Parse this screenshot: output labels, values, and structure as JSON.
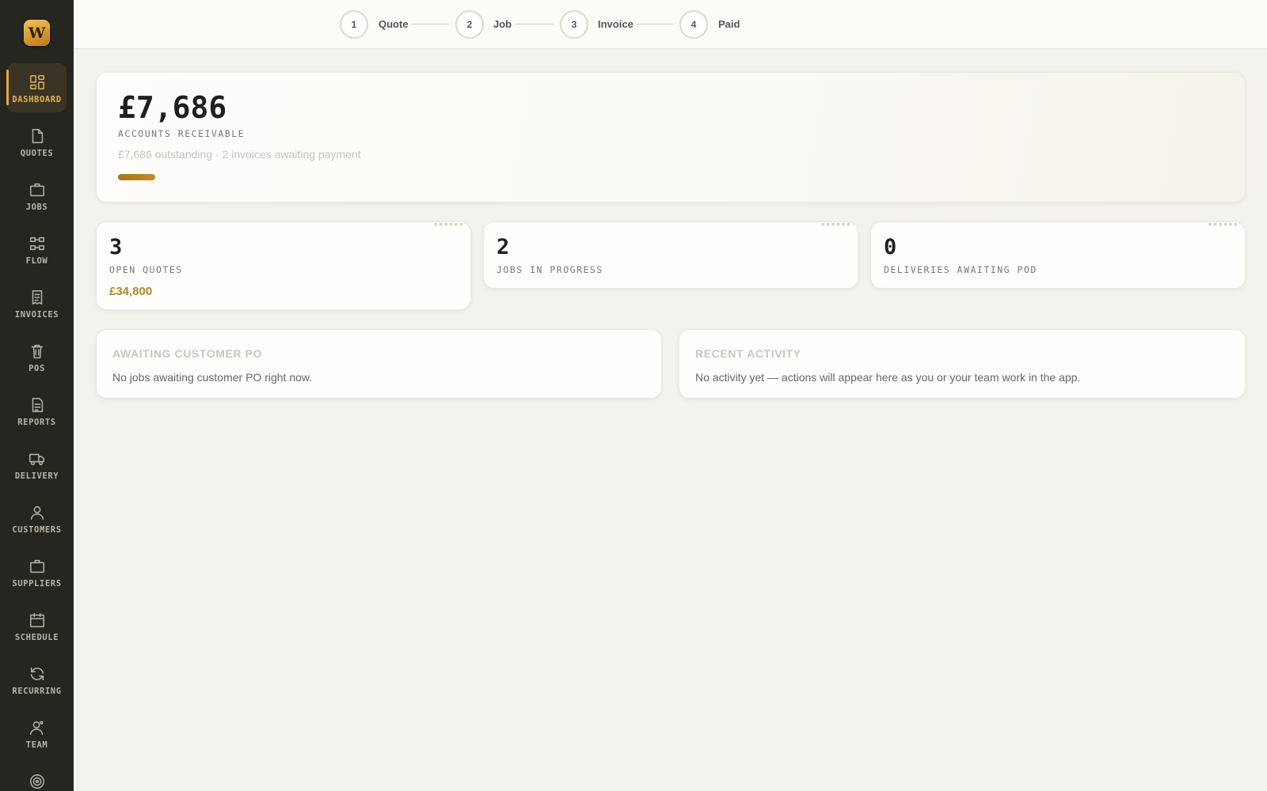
{
  "app": {
    "logo_letter": "W"
  },
  "sidebar": {
    "items": [
      {
        "label": "DASHBOARD",
        "icon": "dashboard-icon",
        "active": true
      },
      {
        "label": "QUOTES",
        "icon": "document-icon"
      },
      {
        "label": "JOBS",
        "icon": "briefcase-icon"
      },
      {
        "label": "FLOW",
        "icon": "flow-icon"
      },
      {
        "label": "INVOICES",
        "icon": "receipt-icon"
      },
      {
        "label": "POS",
        "icon": "trash-icon"
      },
      {
        "label": "REPORTS",
        "icon": "report-icon"
      },
      {
        "label": "DELIVERY",
        "icon": "truck-icon"
      },
      {
        "label": "CUSTOMERS",
        "icon": "user-icon"
      },
      {
        "label": "SUPPLIERS",
        "icon": "briefcase-icon"
      },
      {
        "label": "SCHEDULE",
        "icon": "calendar-icon"
      },
      {
        "label": "RECURRING",
        "icon": "refresh-icon"
      },
      {
        "label": "TEAM",
        "icon": "team-icon"
      }
    ]
  },
  "workflow": {
    "steps": [
      {
        "number": "1",
        "label": "Quote"
      },
      {
        "number": "2",
        "label": "Job"
      },
      {
        "number": "3",
        "label": "Invoice"
      },
      {
        "number": "4",
        "label": "Paid"
      }
    ]
  },
  "receivables": {
    "amount": "£7,686",
    "label": "ACCOUNTS RECEIVABLE",
    "subtitle": "£7,686 outstanding · 2 invoices awaiting payment"
  },
  "stats": [
    {
      "number": "3",
      "label": "OPEN QUOTES",
      "value": "£34,800"
    },
    {
      "number": "2",
      "label": "JOBS IN PROGRESS"
    },
    {
      "number": "0",
      "label": "DELIVERIES AWAITING POD"
    }
  ],
  "panels": {
    "awaiting_po": {
      "title": "AWAITING CUSTOMER PO",
      "text": "No jobs awaiting customer PO right now."
    },
    "recent_activity": {
      "title": "RECENT ACTIVITY",
      "text": "No activity yet — actions will appear here as you or your team work in the app."
    }
  },
  "colors": {
    "sidebar_bg": "#25261f",
    "accent": "#e4a83a",
    "accent_text": "#b5852b"
  }
}
